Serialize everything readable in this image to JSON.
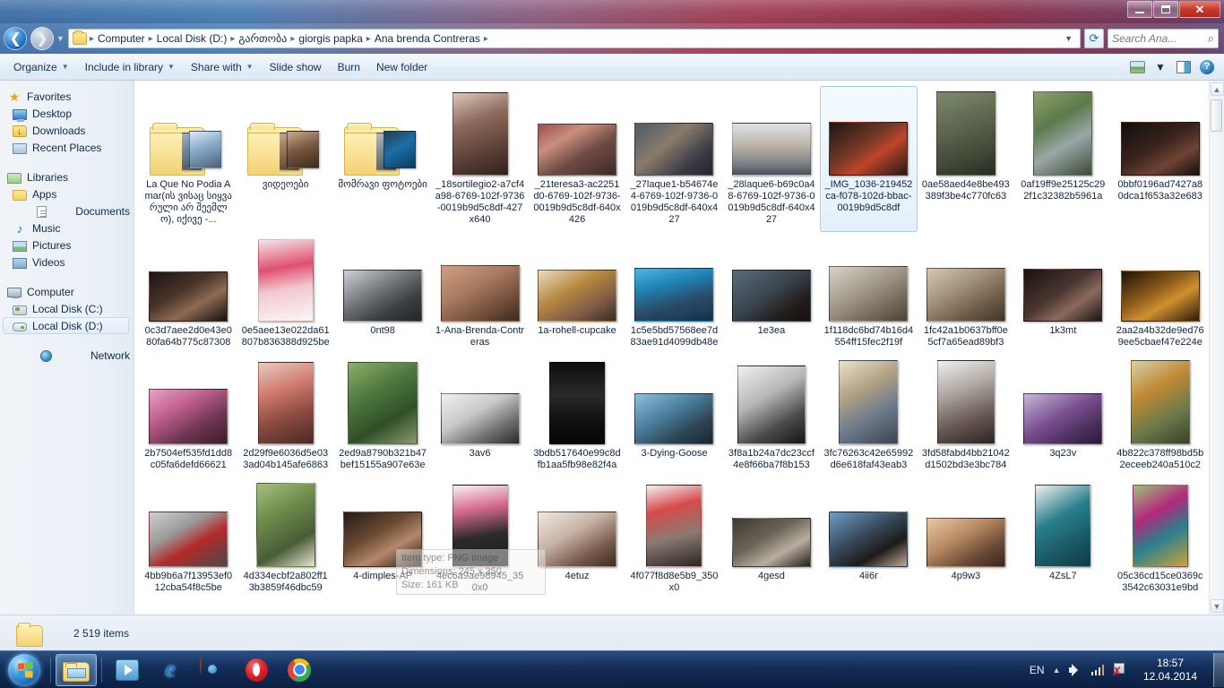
{
  "window": {
    "minimize_label": "Minimize",
    "maximize_label": "Maximize",
    "close_label": "✕"
  },
  "address": {
    "back_label": "❮",
    "forward_label": "❯",
    "crumbs": [
      "Computer",
      "Local Disk (D:)",
      "გართობა",
      "giorgis papka",
      "Ana brenda Contreras"
    ],
    "separator": "▸",
    "dropdown_caret": "▼",
    "refresh_label": "⟳",
    "search_placeholder": "Search Ana...",
    "search_value": "",
    "search_icon": "⌕"
  },
  "toolbar": {
    "items": [
      {
        "label": "Organize",
        "has_caret": true
      },
      {
        "label": "Include in library",
        "has_caret": true
      },
      {
        "label": "Share with",
        "has_caret": true
      },
      {
        "label": "Slide show",
        "has_caret": false
      },
      {
        "label": "Burn",
        "has_caret": false
      },
      {
        "label": "New folder",
        "has_caret": false
      }
    ],
    "views_caret": "▼",
    "help_label": "?"
  },
  "sidebar": {
    "groups": [
      {
        "root": {
          "label": "Favorites",
          "icon": "star-icon"
        },
        "items": [
          {
            "label": "Desktop",
            "icon": "desktop-icon"
          },
          {
            "label": "Downloads",
            "icon": "downloads-icon"
          },
          {
            "label": "Recent Places",
            "icon": "recent-places-icon"
          }
        ]
      },
      {
        "root": {
          "label": "Libraries",
          "icon": "libraries-icon"
        },
        "items": [
          {
            "label": "Apps",
            "icon": "folder-icon"
          },
          {
            "label": "Documents",
            "icon": "document-icon"
          },
          {
            "label": "Music",
            "icon": "music-icon"
          },
          {
            "label": "Pictures",
            "icon": "picture-icon"
          },
          {
            "label": "Videos",
            "icon": "video-icon"
          }
        ]
      },
      {
        "root": {
          "label": "Computer",
          "icon": "computer-icon"
        },
        "items": [
          {
            "label": "Local Disk (C:)",
            "icon": "disk-c-icon",
            "selected": false
          },
          {
            "label": "Local Disk (D:)",
            "icon": "disk-d-icon",
            "selected": true
          }
        ]
      },
      {
        "root": {
          "label": "Network",
          "icon": "network-icon"
        },
        "items": []
      }
    ]
  },
  "files": [
    {
      "name": "La Que No Podia Amar(ის ვისაც სიყვარული არ შეემლო), იქივე -...",
      "type": "folder",
      "selected": false
    },
    {
      "name": "ვიდეოები",
      "type": "folder",
      "selected": false
    },
    {
      "name": "მომრავი ფოტოები",
      "type": "folder",
      "selected": false
    },
    {
      "name": "_18sortilegio2-a7cf4a98-6769-102f-9736-0019b9d5c8df-427x640",
      "type": "image",
      "selected": false
    },
    {
      "name": "_21teresa3-ac2251d0-6769-102f-9736-0019b9d5c8df-640x426",
      "type": "image",
      "selected": false
    },
    {
      "name": "_27laque1-b54674e4-6769-102f-9736-0019b9d5c8df-640x427",
      "type": "image",
      "selected": false
    },
    {
      "name": "_28laque6-b69c0a48-6769-102f-9736-0019b9d5c8df-640x427",
      "type": "image",
      "selected": false
    },
    {
      "name": "_IMG_1036-219452ca-f078-102d-bbac-0019b9d5c8df",
      "type": "image",
      "selected": true
    },
    {
      "name": "0ae58aed4e8be493389f3be4c770fc63",
      "type": "image",
      "selected": false
    },
    {
      "name": "0af19ff9e25125c292f1c32382b5961a",
      "type": "image",
      "selected": false
    },
    {
      "name": "0bbf0196ad7427a80dca1f653a32e683",
      "type": "image",
      "selected": false
    },
    {
      "name": "0c3d7aee2d0e43e080fa64b775c87308",
      "type": "image",
      "selected": false
    },
    {
      "name": "0e5aee13e022da61807b836388d925be",
      "type": "image",
      "selected": false
    },
    {
      "name": "0nt98",
      "type": "image",
      "selected": false
    },
    {
      "name": "1-Ana-Brenda-Contreras",
      "type": "image",
      "selected": false
    },
    {
      "name": "1a-rohell-cupcake",
      "type": "image",
      "selected": false
    },
    {
      "name": "1c5e5bd57568ee7d83ae91d4099db48e",
      "type": "image",
      "selected": false
    },
    {
      "name": "1e3ea",
      "type": "image",
      "selected": false
    },
    {
      "name": "1f118dc6bd74b16d4554ff15fec2f19f",
      "type": "image",
      "selected": false
    },
    {
      "name": "1fc42a1b0637bff0e5cf7a65ead89bf3",
      "type": "image",
      "selected": false
    },
    {
      "name": "1k3mt",
      "type": "image",
      "selected": false
    },
    {
      "name": "2aa2a4b32de9ed769ee5cbaef47e224e",
      "type": "image",
      "selected": false
    },
    {
      "name": "2b7504ef535fd1dd8c05fa6defd66621",
      "type": "image",
      "selected": false
    },
    {
      "name": "2d29f9e6036d5e033ad04b145afe6863",
      "type": "image",
      "selected": false
    },
    {
      "name": "2ed9a8790b321b47bef15155a907e63e",
      "type": "image",
      "selected": false
    },
    {
      "name": "3av6",
      "type": "image",
      "selected": false
    },
    {
      "name": "3bdb517640e99c8dfb1aa5fb98e82f4a",
      "type": "image",
      "selected": false
    },
    {
      "name": "3-Dying-Goose",
      "type": "image",
      "selected": false
    },
    {
      "name": "3f8a1b24a7dc23ccf4e8f66ba7f8b153",
      "type": "image",
      "selected": false
    },
    {
      "name": "3fc76263c42e65992d6e618faf43eab3",
      "type": "image",
      "selected": false
    },
    {
      "name": "3fd58fabd4bb21042d1502bd3e3bc784",
      "type": "image",
      "selected": false
    },
    {
      "name": "3q23v",
      "type": "image",
      "selected": false
    },
    {
      "name": "4b822c378ff98bd5b2eceeb240a510c2",
      "type": "image",
      "selected": false
    },
    {
      "name": "4bb9b6a7f13953ef012cba54f8c5be",
      "type": "image",
      "selected": false
    },
    {
      "name": "4d334ecbf2a802ff13b3859f46dbc59",
      "type": "image",
      "selected": false
    },
    {
      "name": "4-dimples-AP",
      "type": "image",
      "selected": false
    },
    {
      "name": "4ec6a9ae98945_350x0",
      "type": "image",
      "selected": false
    },
    {
      "name": "4etuz",
      "type": "image",
      "selected": false
    },
    {
      "name": "4f077f8d8e5b9_350x0",
      "type": "image",
      "selected": false
    },
    {
      "name": "4gesd",
      "type": "image",
      "selected": false
    },
    {
      "name": "4ii6r",
      "type": "image",
      "selected": false
    },
    {
      "name": "4p9w3",
      "type": "image",
      "selected": false
    },
    {
      "name": "4ZsL7",
      "type": "image",
      "selected": false
    },
    {
      "name": "05c36cd15ce0369c3542c63031e9bd",
      "type": "image",
      "selected": false
    }
  ],
  "tooltip": {
    "line1": "Item type: PNG image",
    "line2": "Dimensions: 245 x 350",
    "line3": "Size: 161 KB"
  },
  "statusbar": {
    "item_count": "2 519 items"
  },
  "scrollbar": {
    "up_arrow": "▲",
    "down_arrow": "▼"
  },
  "taskbar": {
    "start_label": "Start",
    "items": [
      {
        "name": "windows-explorer",
        "icon": "explorer-icon",
        "active": true
      },
      {
        "name": "windows-media-player",
        "icon": "media-player-icon",
        "active": false
      },
      {
        "name": "internet-explorer",
        "icon": "ie-icon",
        "active": false,
        "glyph": "e"
      },
      {
        "name": "firefox",
        "icon": "firefox-icon",
        "active": false
      },
      {
        "name": "opera",
        "icon": "opera-icon",
        "active": false
      },
      {
        "name": "chrome",
        "icon": "chrome-icon",
        "active": false
      }
    ],
    "tray": {
      "language": "EN",
      "show_hidden": "▲",
      "time": "18:57",
      "date": "12.04.2014"
    }
  },
  "colors": {
    "accent": "#1766b8",
    "selection": "#a9cbe8",
    "close_button": "#c7392b"
  }
}
